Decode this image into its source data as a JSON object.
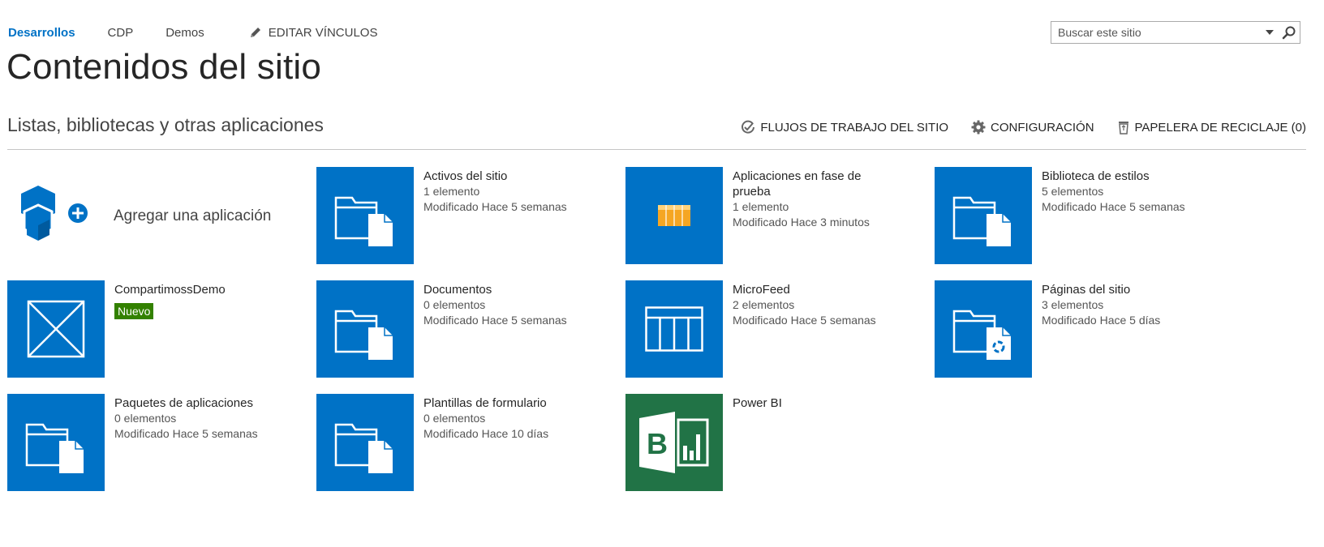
{
  "topnav": {
    "links": [
      "Desarrollos",
      "CDP",
      "Demos"
    ],
    "edit_links": "EDITAR VÍNCULOS"
  },
  "search": {
    "placeholder": "Buscar este sitio"
  },
  "page_title": "Contenidos del sitio",
  "section_title": "Listas, bibliotecas y otras aplicaciones",
  "actions": {
    "workflows": "FLUJOS DE TRABAJO DEL SITIO",
    "settings": "CONFIGURACIÓN",
    "recycle_bin": "PAPELERA DE RECICLAJE (0)"
  },
  "add_app_label": "Agregar una aplicación",
  "tiles": [
    {
      "name": "Activos del sitio",
      "count": "1 elemento",
      "modified": "Modificado Hace 5 semanas",
      "icon": "folder-document-icon"
    },
    {
      "name": "Aplicaciones en fase de prueba",
      "count": "1 elemento",
      "modified": "Modificado Hace 3 minutos",
      "icon": "table-list-icon"
    },
    {
      "name": "Biblioteca de estilos",
      "count": "5 elementos",
      "modified": "Modificado Hace 5 semanas",
      "icon": "folder-document-icon"
    },
    {
      "name": "CompartimossDemo",
      "badge": "Nuevo",
      "icon": "placeholder-app-icon"
    },
    {
      "name": "Documentos",
      "count": "0 elementos",
      "modified": "Modificado Hace 5 semanas",
      "icon": "folder-document-icon"
    },
    {
      "name": "MicroFeed",
      "count": "2 elementos",
      "modified": "Modificado Hace 5 semanas",
      "icon": "list-columns-icon"
    },
    {
      "name": "Páginas del sitio",
      "count": "3 elementos",
      "modified": "Modificado Hace 5 días",
      "icon": "folder-pages-icon"
    },
    {
      "name": "Paquetes de aplicaciones",
      "count": "0 elementos",
      "modified": "Modificado Hace 5 semanas",
      "icon": "folder-document-icon"
    },
    {
      "name": "Plantillas de formulario",
      "count": "0 elementos",
      "modified": "Modificado Hace 10 días",
      "icon": "folder-document-icon"
    },
    {
      "name": "Power BI",
      "icon": "power-bi-icon"
    }
  ],
  "colors": {
    "tile_blue": "#0072c6",
    "power_bi_green": "#217346",
    "badge_green": "#338100",
    "nav_active": "#0072c6"
  }
}
